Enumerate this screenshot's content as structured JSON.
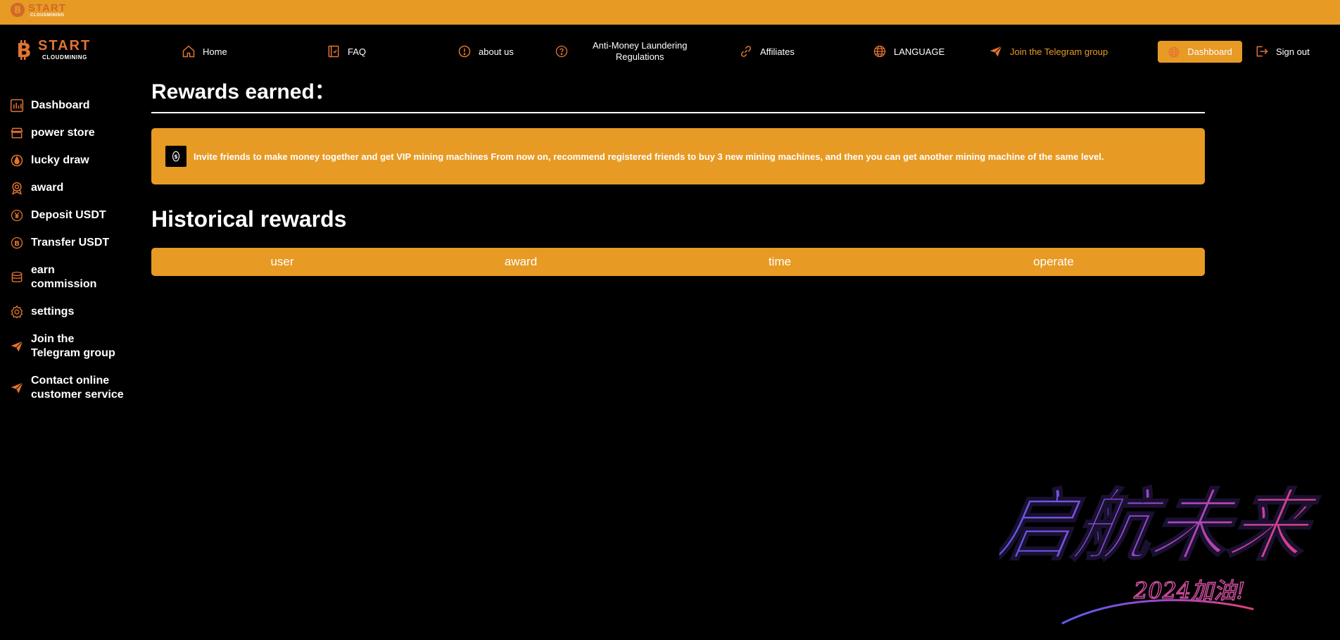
{
  "brand": {
    "name": "START",
    "sub": "CLOUDMINING",
    "logo_icon": "bitcoin-coin-icon",
    "accent": "#E79A24",
    "brand_orange": "#E3742F"
  },
  "nav": {
    "home": "Home",
    "faq": "FAQ",
    "about": "about us",
    "aml_line1": "Anti-Money Laundering",
    "aml_line2": "Regulations",
    "affiliates": "Affiliates",
    "language": "LANGUAGE",
    "telegram": "Join the Telegram group",
    "dashboard": "Dashboard",
    "signout": "Sign out"
  },
  "sidebar": {
    "items": [
      {
        "label": "Dashboard",
        "icon": "bar-chart-icon"
      },
      {
        "label": "power store",
        "icon": "store-icon"
      },
      {
        "label": "lucky draw",
        "icon": "drop-icon"
      },
      {
        "label": "award",
        "icon": "medal-icon"
      },
      {
        "label": "Deposit USDT",
        "icon": "yen-coin-icon"
      },
      {
        "label": "Transfer USDT",
        "icon": "bitcoin-icon"
      },
      {
        "label_line1": "earn",
        "label_line2": "commission",
        "icon": "database-icon"
      },
      {
        "label": "settings",
        "icon": "gear-icon"
      },
      {
        "label_line1": "Join the",
        "label_line2": "Telegram group",
        "icon": "paper-plane-icon"
      },
      {
        "label_line1": "Contact online",
        "label_line2": "customer service",
        "icon": "paper-plane-icon"
      }
    ]
  },
  "main": {
    "rewards_title": "Rewards earned：",
    "notice": "Invite friends to make money together and get VIP mining machines From now on, recommend registered friends to buy 3 new mining machines, and then you can get another mining machine of the same level.",
    "history_title": "Historical rewards",
    "table": {
      "columns": [
        "user",
        "award",
        "time",
        "operate"
      ],
      "rows": []
    }
  },
  "decor": {
    "calligraphy_main": "启航未来",
    "calligraphy_sub": "2024加油!"
  }
}
